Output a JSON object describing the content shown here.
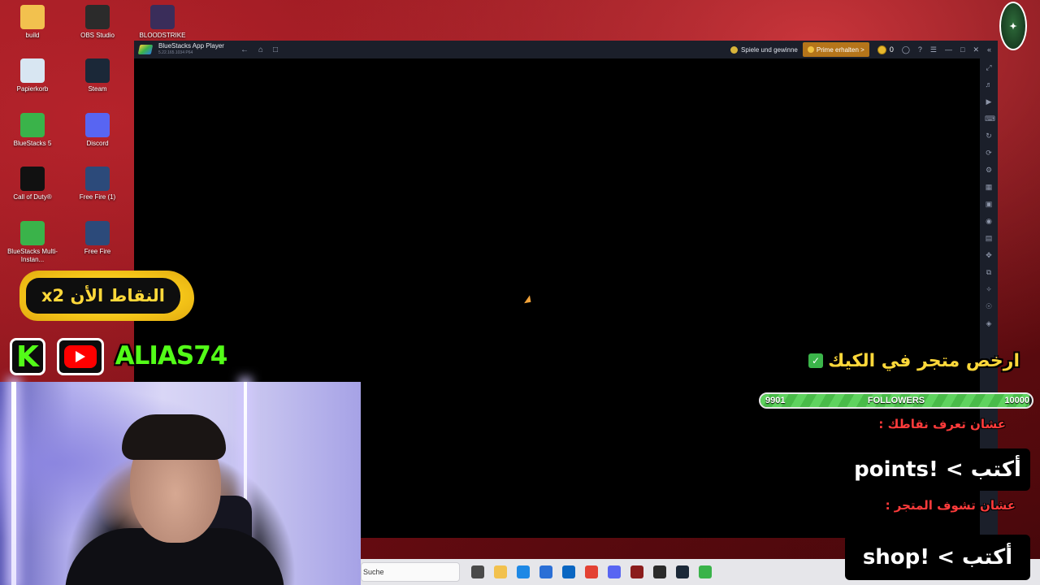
{
  "desktop": {
    "icons": [
      {
        "label": "build",
        "icon": "folder-icon",
        "color": "#f2c14e"
      },
      {
        "label": "OBS Studio",
        "icon": "obs-icon",
        "color": "#2b2b2b"
      },
      {
        "label": "BLOODSTRIKE",
        "icon": "bloodstrike-icon",
        "color": "#3a2d5a"
      },
      {
        "label": "Papierkorb",
        "icon": "recycle-bin-icon",
        "color": "#d8e6f2"
      },
      {
        "label": "Steam",
        "icon": "steam-icon",
        "color": "#1b2838"
      },
      {
        "label": "BlueStacks 5",
        "icon": "bluestacks-icon",
        "color": "#3ab34a"
      },
      {
        "label": "Discord",
        "icon": "discord-icon",
        "color": "#5865f2"
      },
      {
        "label": "Call of Duty®",
        "icon": "call-of-duty-icon",
        "color": "#111111"
      },
      {
        "label": "Free Fire (1)",
        "icon": "free-fire-icon",
        "color": "#2c4a7a"
      },
      {
        "label": "BlueStacks Multi-Instan...",
        "icon": "bluestacks-multi-icon",
        "color": "#3ab34a"
      },
      {
        "label": "Free Fire",
        "icon": "free-fire-icon",
        "color": "#2c4a7a"
      }
    ]
  },
  "bluestacks": {
    "title": "BlueStacks App Player",
    "version": "5.22.165.1034 P64",
    "play_label": "Spiele und gewinne",
    "prime_label": "Prime erhalten >",
    "coins": "0",
    "accent_prime": "#b5751a"
  },
  "taskbar": {
    "search_placeholder": "Suche"
  },
  "overlay": {
    "points_badge": "النقاط الأن x2",
    "channel_name": "ALIAS74",
    "kick_letter": "K",
    "store_title": "ارخص متجر في الكيك",
    "store_check": "✓",
    "followers": {
      "label": "FOLLOWERS",
      "current": "9901",
      "goal": "10000",
      "progress": 0.99
    },
    "hint_points": "عشان تعرف نقاطك :",
    "cmd_points": "أكتب > !points",
    "hint_shop": "عشان تشوف المتجر :",
    "cmd_shop": "أكتب > !shop"
  }
}
